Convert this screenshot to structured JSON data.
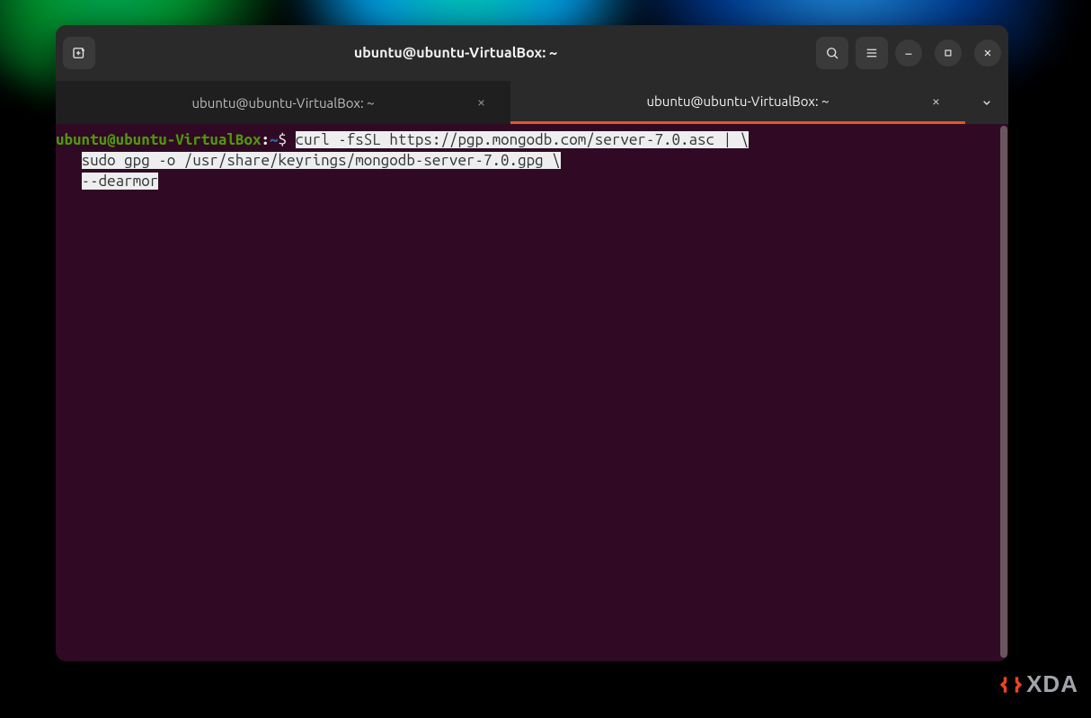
{
  "window": {
    "title": "ubuntu@ubuntu-VirtualBox: ~"
  },
  "tabs": [
    {
      "label": "ubuntu@ubuntu-VirtualBox: ~",
      "active": false
    },
    {
      "label": "ubuntu@ubuntu-VirtualBox: ~",
      "active": true
    }
  ],
  "prompt": {
    "user_host": "ubuntu@ubuntu-VirtualBox",
    "path": "~",
    "symbol": "$"
  },
  "command": {
    "line1": "curl -fsSL https://pgp.mongodb.com/server-7.0.asc | \\",
    "line2_indent": "   ",
    "line2": "sudo gpg -o /usr/share/keyrings/mongodb-server-7.0.gpg \\",
    "line3_indent": "   ",
    "line3": "--dearmor"
  },
  "icons": {
    "new_tab": "new-tab-icon",
    "search": "search-icon",
    "hamburger": "hamburger-icon",
    "minimize": "minimize-icon",
    "maximize": "maximize-icon",
    "close": "close-icon",
    "tab_close": "×",
    "chevron_down": "chevron-down-icon"
  },
  "watermark": {
    "text": "XDA"
  },
  "colors": {
    "accent": "#e95420",
    "terminal_bg": "#300a24",
    "prompt_user": "#4e9a06",
    "prompt_path": "#3465a4",
    "selection_bg": "#eeeeee",
    "selection_fg": "#2e3436"
  }
}
